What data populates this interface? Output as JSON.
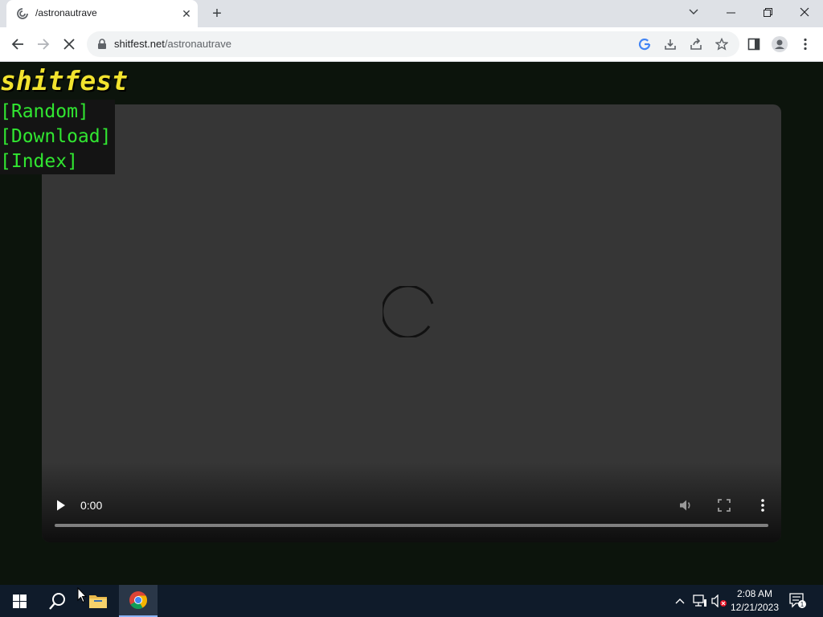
{
  "browser": {
    "tab_title": "/astronautrave",
    "url_domain": "shitfest.net",
    "url_path": "/astronautrave"
  },
  "page": {
    "site_title": "shitfest",
    "nav": [
      "[Random]",
      "[Download]",
      "[Index]"
    ]
  },
  "video": {
    "time": "0:00"
  },
  "taskbar": {
    "time": "2:08 AM",
    "date": "12/21/2023",
    "notification_count": "1"
  },
  "colors": {
    "title": "#f2e32e",
    "nav": "#31e631",
    "background": "#0c140c"
  }
}
